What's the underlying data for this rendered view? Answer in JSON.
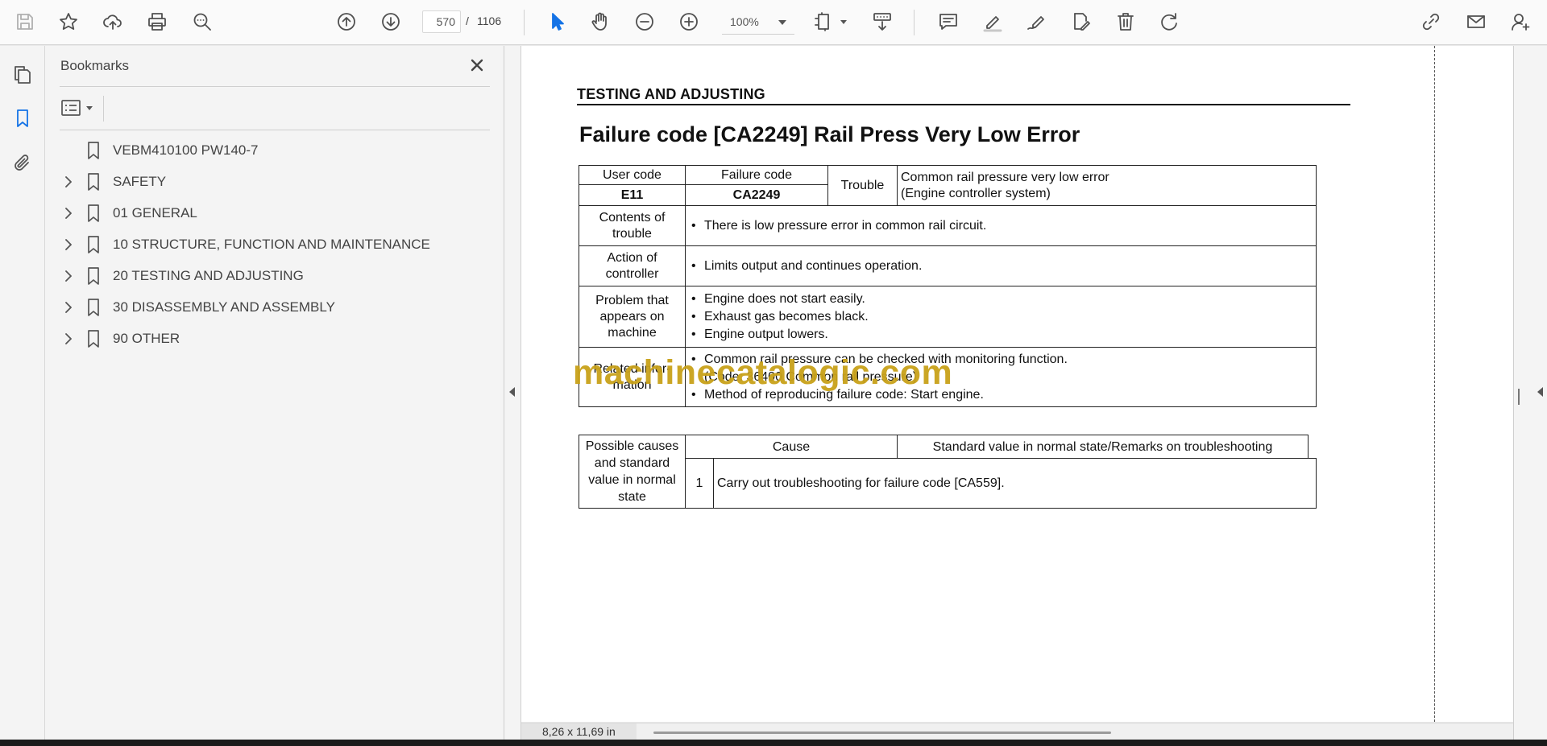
{
  "toolbar": {
    "current_page": "570",
    "page_separator": "/",
    "total_pages": "1106",
    "zoom": "100%"
  },
  "bookmarks": {
    "title": "Bookmarks",
    "items": [
      {
        "label": "VEBM410100 PW140-7",
        "expandable": false
      },
      {
        "label": "SAFETY",
        "expandable": true
      },
      {
        "label": "01 GENERAL",
        "expandable": true
      },
      {
        "label": "10 STRUCTURE, FUNCTION AND MAINTENANCE",
        "expandable": true
      },
      {
        "label": "20 TESTING AND ADJUSTING",
        "expandable": true
      },
      {
        "label": "30 DISASSEMBLY AND ASSEMBLY",
        "expandable": true
      },
      {
        "label": "90 OTHER",
        "expandable": true
      }
    ]
  },
  "document": {
    "section_header": "TESTING AND ADJUSTING",
    "title": "Failure code [CA2249] Rail Press Very Low Error",
    "info_table": {
      "user_code_header": "User code",
      "failure_code_header": "Failure code",
      "user_code": "E11",
      "failure_code": "CA2249",
      "trouble_label": "Trouble",
      "trouble_line1": "Common rail pressure very low error",
      "trouble_line2": "(Engine controller system)",
      "contents_label_1": "Contents of",
      "contents_label_2": "trouble",
      "contents_text": "There is low pressure error in common rail circuit.",
      "action_label_1": "Action of",
      "action_label_2": "controller",
      "action_text": "Limits output and continues operation.",
      "problem_label_1": "Problem that",
      "problem_label_2": "appears on",
      "problem_label_3": "machine",
      "problem_items": [
        "Engine does not start easily.",
        "Exhaust gas becomes black.",
        "Engine output lowers."
      ],
      "related_label_1": "Related infor-",
      "related_label_2": "mation",
      "related_item1": "Common rail pressure can be checked with monitoring function.",
      "related_item1_sub": "(Code: 36400 Common rail pressure)",
      "related_item2": "Method of reproducing failure code: Start engine."
    },
    "cause_table": {
      "left_label_1": "Possible causes",
      "left_label_2": "and standard",
      "left_label_3": "value in normal",
      "left_label_4": "state",
      "cause_header": "Cause",
      "standard_header": "Standard value in normal state/Remarks on troubleshooting",
      "row_number": "1",
      "row_text": "Carry out troubleshooting for failure code [CA559]."
    },
    "watermark": "machinecatalogic.com"
  },
  "status": {
    "page_size": "8,26 x 11,69 in"
  },
  "colors": {
    "accent": "#1473e6",
    "watermark": "#c9a21a"
  }
}
